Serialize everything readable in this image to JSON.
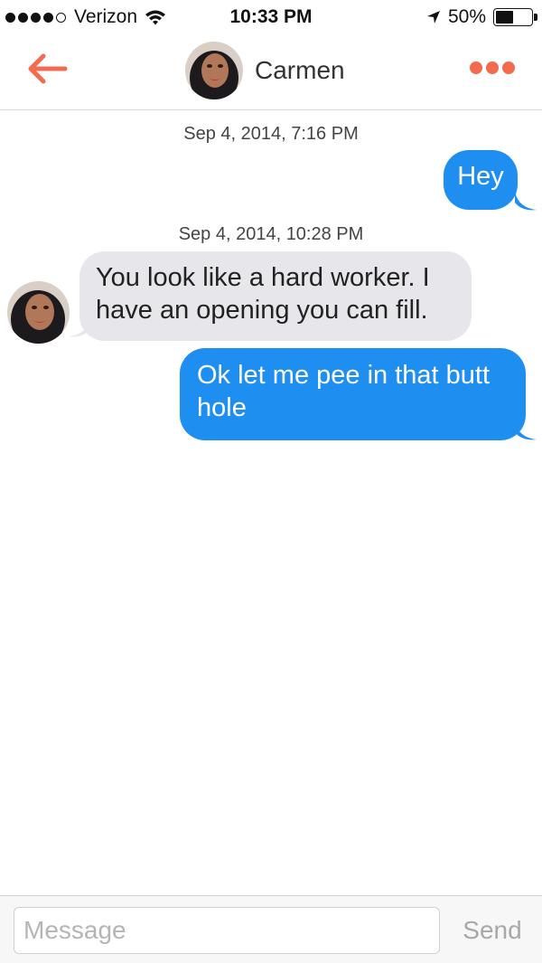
{
  "status_bar": {
    "carrier": "Verizon",
    "time": "10:33 PM",
    "battery_percent": "50%",
    "battery_level": 0.5,
    "signal_bars": 4,
    "signal_total": 5,
    "icons": [
      "wifi-icon",
      "location-arrow-icon",
      "battery-icon"
    ]
  },
  "header": {
    "contact_name": "Carmen",
    "back_icon": "arrow-left-icon",
    "more_icon": "more-dots-icon"
  },
  "conversation": {
    "timestamp_1": "Sep 4, 2014, 7:16 PM",
    "message_1": "Hey",
    "timestamp_2": "Sep 4, 2014, 10:28 PM",
    "message_2_line_1": "You look like a hard worker. I",
    "message_2_line_2": "have an opening you can fill.",
    "message_3_line_1": "Ok let me pee in that butt",
    "message_3_line_2": "hole"
  },
  "composer": {
    "placeholder": "Message",
    "value": "",
    "send_label": "Send"
  },
  "colors": {
    "accent": "#f26b4f",
    "outgoing_bubble": "#1f8ef1",
    "incoming_bubble": "#e6e6eb",
    "send_disabled": "#a8a8a8"
  }
}
